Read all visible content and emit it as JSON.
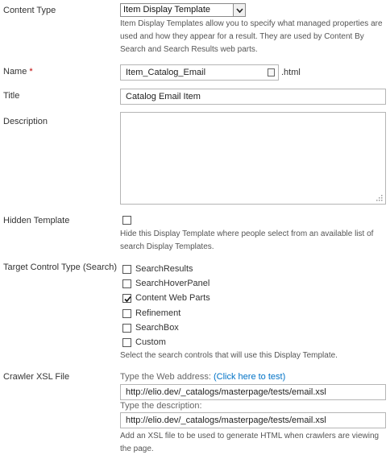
{
  "content_type": {
    "label": "Content Type",
    "selected": "Item Display Template",
    "help": "Item Display Templates allow you to specify what managed properties are used and how they appear for a result.  They are used by Content By Search and Search Results web parts."
  },
  "name": {
    "label": "Name",
    "required_mark": "*",
    "value": "Item_Catalog_Email",
    "suffix": ".html"
  },
  "title": {
    "label": "Title",
    "value": "Catalog Email Item"
  },
  "description": {
    "label": "Description",
    "value": ""
  },
  "hidden_template": {
    "label": "Hidden Template",
    "checked": false,
    "help": "Hide this Display Template where people select from an available list of search Display Templates."
  },
  "target_control": {
    "label": "Target Control Type (Search)",
    "options": [
      {
        "label": "SearchResults",
        "checked": false
      },
      {
        "label": "SearchHoverPanel",
        "checked": false
      },
      {
        "label": "Content Web Parts",
        "checked": true
      },
      {
        "label": "Refinement",
        "checked": false
      },
      {
        "label": "SearchBox",
        "checked": false
      },
      {
        "label": "Custom",
        "checked": false
      }
    ],
    "help": "Select the search controls that will use this Display Template."
  },
  "crawler_xsl": {
    "label": "Crawler XSL File",
    "address_prompt": "Type the Web address: ",
    "test_link_open": "(",
    "test_link": "Click here to test",
    "test_link_close": ")",
    "address_value": "http://elio.dev/_catalogs/masterpage/tests/email.xsl",
    "description_prompt": "Type the description:",
    "description_value": "http://elio.dev/_catalogs/masterpage/tests/email.xsl",
    "help": "Add an XSL file to be used to generate HTML when crawlers are viewing the page."
  },
  "colors": {
    "link": "#0072c6",
    "required": "#bf0000"
  }
}
